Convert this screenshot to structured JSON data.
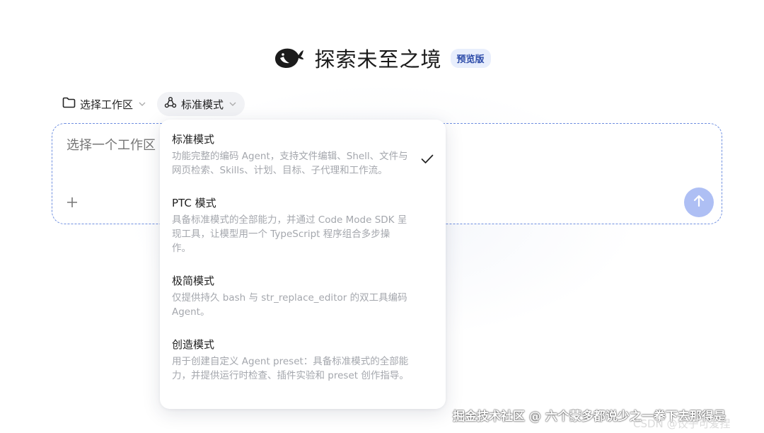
{
  "header": {
    "title": "探索未至之境",
    "badge": "预览版"
  },
  "toolbar": {
    "workspace_label": "选择工作区",
    "mode_label": "标准模式"
  },
  "input": {
    "placeholder": "选择一个工作区"
  },
  "dropdown": {
    "options": [
      {
        "title": "标准模式",
        "description": "功能完整的编码 Agent，支持文件编辑、Shell、文件与网页检索、Skills、计划、目标、子代理和工作流。",
        "selected": true
      },
      {
        "title": "PTC 模式",
        "description": "具备标准模式的全部能力，并通过 Code Mode SDK 呈现工具，让模型用一个 TypeScript 程序组合多步操作。",
        "selected": false
      },
      {
        "title": "极简模式",
        "description": "仅提供持久 bash 与 str_replace_editor 的双工具编码 Agent。",
        "selected": false
      },
      {
        "title": "创造模式",
        "description": "用于创建自定义 Agent preset：具备标准模式的全部能力，并提供运行时检查、插件实验和 preset 创作指导。",
        "selected": false
      }
    ]
  },
  "watermark": {
    "primary": "掘金技术社区 @ 六个蒙多都说少之一拳下去那得是",
    "secondary": "CSDN @饺子可爱捏"
  },
  "colors": {
    "accent": "#6f8fe0",
    "send_button": "#aebff4",
    "badge_bg": "#e8eefc",
    "badge_text": "#2b4aa8"
  },
  "icons": {
    "logo": "whale-logo-icon",
    "workspace": "folder-icon",
    "mode": "recycle-icon",
    "chevron": "chevron-down-icon",
    "check": "check-icon",
    "add": "plus-icon",
    "send": "arrow-up-icon"
  }
}
